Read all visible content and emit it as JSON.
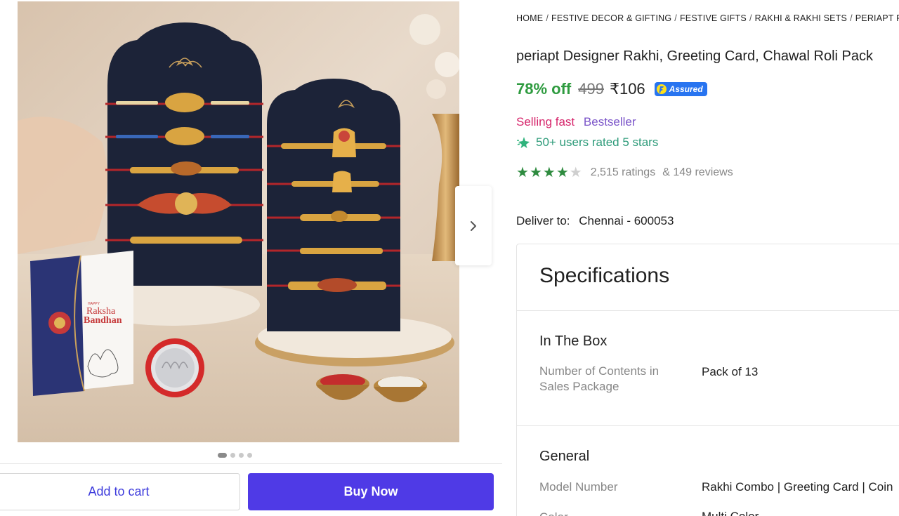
{
  "breadcrumb": [
    "HOME",
    "FESTIVE DECOR & GIFTING",
    "FESTIVE GIFTS",
    "RAKHI & RAKHI SETS",
    "PERIAPT RAKHI"
  ],
  "product": {
    "title": "periapt Designer Rakhi, Greeting Card, Chawal Roli Pack",
    "discount": "78% off",
    "mrp": "499",
    "price": "₹106",
    "assured_label": "Assured",
    "tag_fast": "Selling fast",
    "tag_best": "Bestseller",
    "rated_text": "50+ users rated 5 stars",
    "stars": 4,
    "ratings": "2,515 ratings",
    "reviews": "& 149 reviews"
  },
  "delivery": {
    "label": "Deliver to:",
    "location": "Chennai - 600053"
  },
  "gallery": {
    "image_count": 4,
    "active_index": 0,
    "card_text_top": "HAPPY",
    "card_text_main": "Raksha",
    "card_text_sub": "Bandhan"
  },
  "actions": {
    "cart_label": "Add to cart",
    "buy_label": "Buy Now"
  },
  "specifications": {
    "heading": "Specifications",
    "sections": [
      {
        "title": "In The Box",
        "rows": [
          {
            "key": "Number of Contents in Sales Package",
            "value": "Pack of 13"
          }
        ]
      },
      {
        "title": "General",
        "rows": [
          {
            "key": "Model Number",
            "value": "Rakhi Combo | Greeting Card | Coin"
          },
          {
            "key": "Color",
            "value": "Multi Color"
          }
        ]
      }
    ]
  },
  "colors": {
    "discount": "#2e9b3f",
    "buy_button": "#4f3ae6",
    "link_blue": "#3d3bdc",
    "assured": "#2874f0",
    "selling_fast": "#d6256b",
    "bestseller": "#7b55c9",
    "star": "#2e8b3f"
  }
}
